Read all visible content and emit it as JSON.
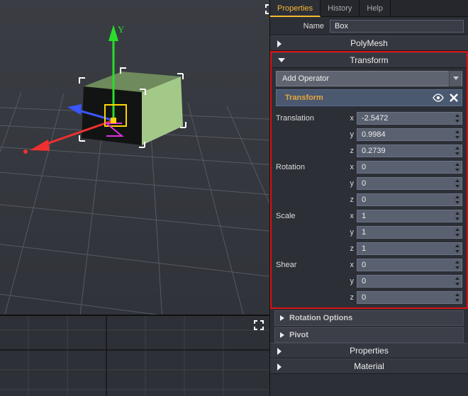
{
  "tabs": {
    "properties": "Properties",
    "history": "History",
    "help": "Help"
  },
  "name": {
    "label": "Name",
    "value": "Box"
  },
  "sections": {
    "polymesh": "PolyMesh",
    "transform": "Transform",
    "properties": "Properties",
    "material": "Material",
    "rotation_options": "Rotation Options",
    "pivot": "Pivot"
  },
  "operator": {
    "add": "Add Operator",
    "transform": "Transform"
  },
  "transform": {
    "translation": {
      "label": "Translation",
      "x": "-2.5472",
      "y": "0.9984",
      "z": "0.2739"
    },
    "rotation": {
      "label": "Rotation",
      "x": "0",
      "y": "0",
      "z": "0"
    },
    "scale": {
      "label": "Scale",
      "x": "1",
      "y": "1",
      "z": "1"
    },
    "shear": {
      "label": "Shear",
      "x": "0",
      "y": "0",
      "z": "0"
    }
  },
  "axis": {
    "x": "x",
    "y": "y",
    "z": "z"
  },
  "gizmo": {
    "ylabel": "Y"
  }
}
